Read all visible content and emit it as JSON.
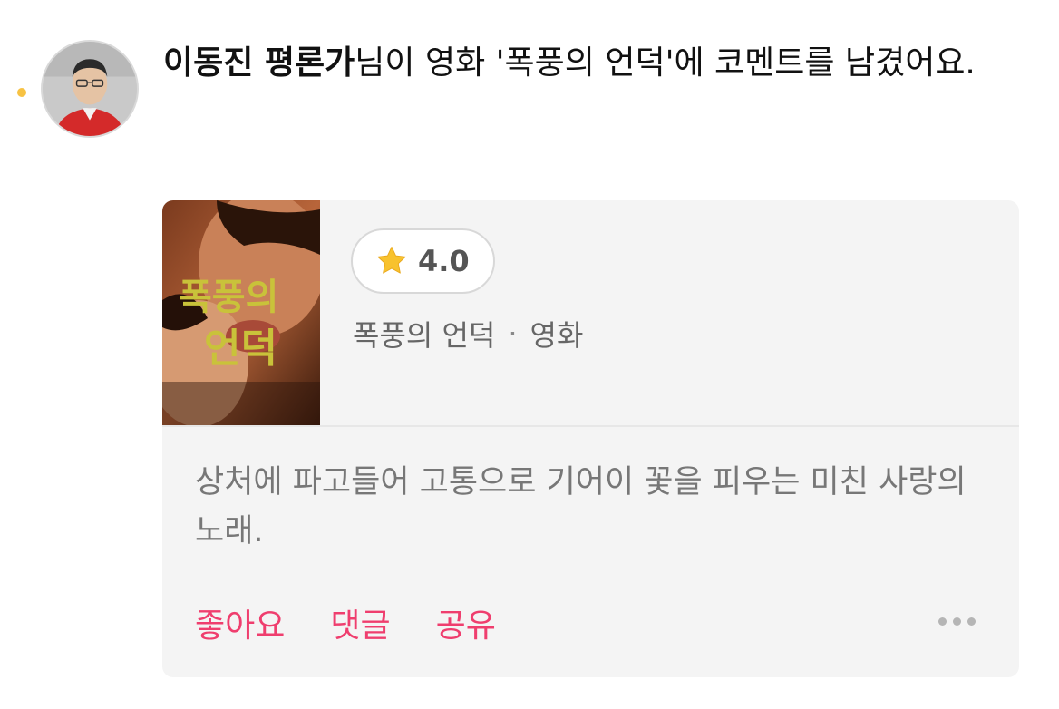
{
  "notification": {
    "critic_name": "이동진 평론가",
    "message": "님이 영화 '폭풍의 언덕'에 코멘트를 남겼어요.",
    "unread_color": "#f7c243"
  },
  "card": {
    "rating": "4.0",
    "movie_title": "폭풍의 언덕",
    "separator": "·",
    "content_type": "영화",
    "comment": "상처에 파고들어 고통으로 기어이 꽃을 피우는 미친 사랑의 노래.",
    "actions": {
      "like": "좋아요",
      "comment": "댓글",
      "share": "공유"
    },
    "accent_color": "#ef3e6e"
  },
  "poster": {
    "title_art": "폭풍의 언덕"
  },
  "icons": [
    "star-icon",
    "more-options-icon"
  ]
}
